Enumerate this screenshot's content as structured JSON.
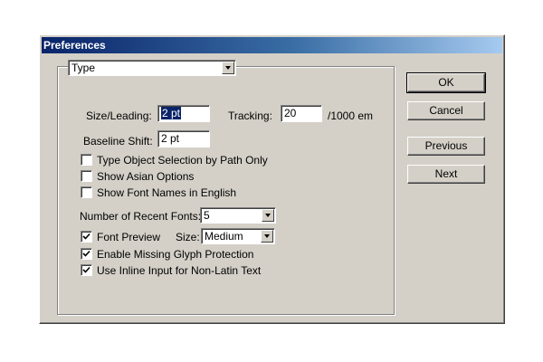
{
  "window": {
    "title": "Preferences"
  },
  "category_select": {
    "value": "Type"
  },
  "size_leading": {
    "label": "Size/Leading:",
    "value": "2 pt"
  },
  "tracking": {
    "label": "Tracking:",
    "value": "20",
    "unit": "/1000 em"
  },
  "baseline_shift": {
    "label": "Baseline Shift:",
    "value": "2 pt"
  },
  "checkboxes": [
    {
      "label": "Type Object Selection by Path Only",
      "checked": false
    },
    {
      "label": "Show Asian Options",
      "checked": false
    },
    {
      "label": "Show Font Names in English",
      "checked": false
    }
  ],
  "recent_fonts": {
    "label": "Number of Recent Fonts:",
    "value": "5"
  },
  "font_preview": {
    "label": "Font Preview",
    "checked": true,
    "size_label": "Size:",
    "size_value": "Medium"
  },
  "checkboxes_bottom": [
    {
      "label": "Enable Missing Glyph Protection",
      "checked": true
    },
    {
      "label": "Use Inline Input for Non-Latin Text",
      "checked": true
    }
  ],
  "buttons": {
    "ok": "OK",
    "cancel": "Cancel",
    "previous": "Previous",
    "next": "Next"
  }
}
